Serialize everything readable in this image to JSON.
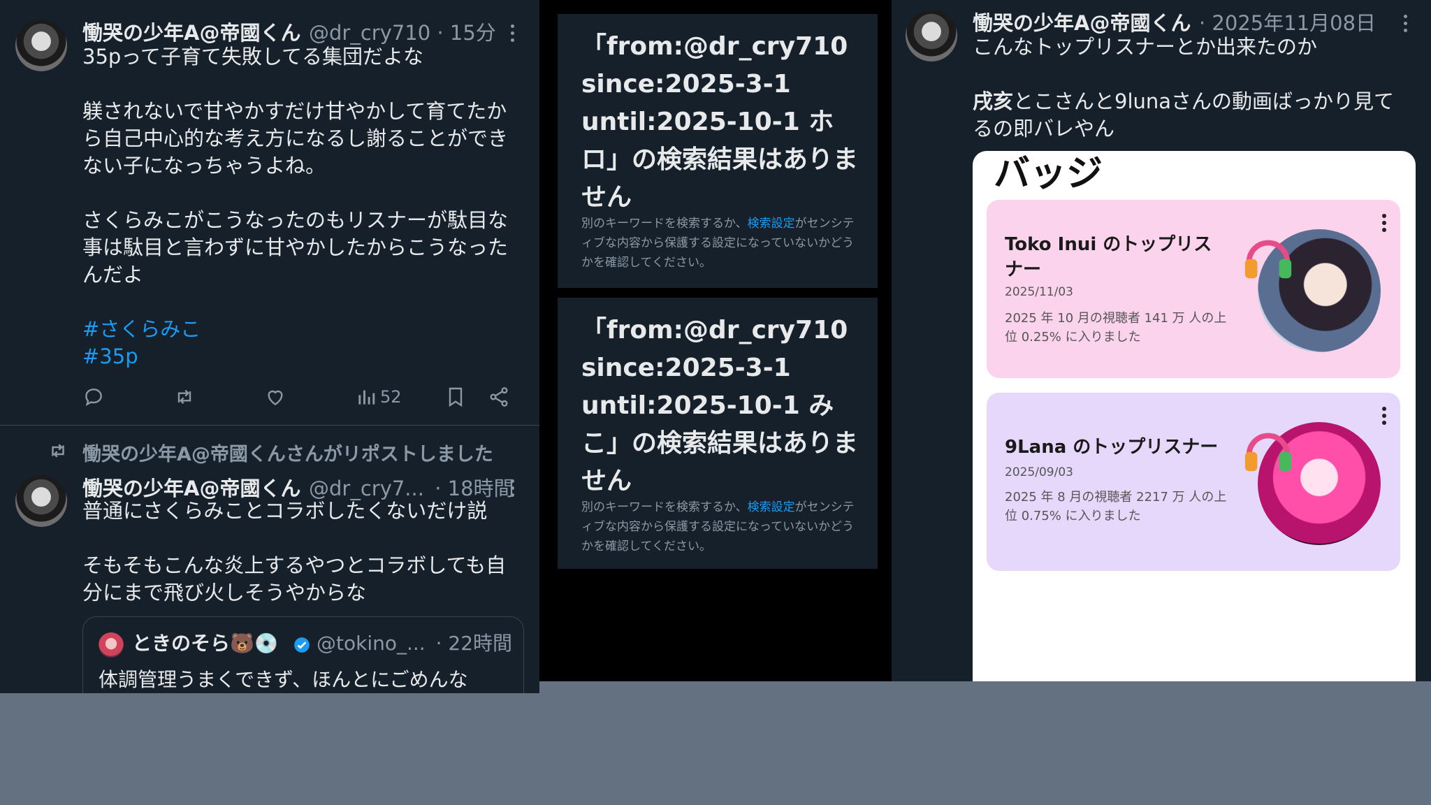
{
  "left": {
    "post1": {
      "name": "慟哭の少年A@帝國くん",
      "handle": "@dr_cry710",
      "time": "· 15分",
      "lines": [
        "35pって子育て失敗してる集団だよな",
        "躾されないで甘やかすだけ甘やかして育てたか",
        "ら自己中心的な考え方になるし謝ることができ",
        "ない子になっちゃうよね。",
        "さくらみこがこうなったのもリスナーが駄目な",
        "事は駄目と言わずに甘やかしたからこうなった",
        "んだよ"
      ],
      "hashtags": [
        "#さくらみこ",
        "#35p"
      ],
      "views": "52"
    },
    "repost_label": "慟哭の少年A@帝國くんさんがリポストしました",
    "post2": {
      "name": "慟哭の少年A@帝國くん",
      "handle": "@dr_cry7...",
      "time": "· 18時間",
      "lines": [
        "普通にさくらみことコラボしたくないだけ説",
        "そもそもこんな炎上するやつとコラボしても自",
        "分にまで飛び火しそうやからな"
      ]
    },
    "quote": {
      "name": "ときのそら🐻💿",
      "handle": "@tokino_...",
      "time": "· 22時間",
      "text": "体調管理うまくできず、ほんとにごめんな"
    }
  },
  "middle": {
    "result1": {
      "title": "「from:@dr_cry710 since:2025-3-1 until:2025-10-1 ホロ」の検索結果はありません",
      "desc_before": "別のキーワードを検索するか、",
      "desc_link": "検索設定",
      "desc_after": "がセンシティブな内容から保護する設定になっていないかどうかを確認してください。"
    },
    "result2": {
      "title": "「from:@dr_cry710 since:2025-3-1 until:2025-10-1 みこ」の検索結果はありません",
      "desc_before": "別のキーワードを検索するか、",
      "desc_link": "検索設定",
      "desc_after": "がセンシティブな内容から保護する設定になっていないかどうかを確認してください。"
    }
  },
  "right": {
    "post": {
      "name": "慟哭の少年A@帝國くん",
      "time": "· 2025年11月08日",
      "line1": "こんなトップリスナーとか出来たのか",
      "line2a": "戌亥",
      "line2b": "とこさんと9lunaさんの動画ばっかり見て",
      "line3": "るの即バレやん"
    },
    "panel_title": "バッジ",
    "badges": [
      {
        "title": "Toko Inui のトップリスナー",
        "date": "2025/11/03",
        "desc": "2025 年 10 月の視聴者 141 万 人の上位 0.25% に入りました",
        "bg": "#fbd3ec"
      },
      {
        "title": "9Lana のトップリスナー",
        "date": "2025/09/03",
        "desc": "2025 年 8 月の視聴者 2217 万 人の上位 0.75% に入りました",
        "bg": "#e6d8fb"
      }
    ]
  },
  "colors": {
    "bg": "#15202b",
    "accent": "#1d9bf0",
    "muted": "#8b98a5",
    "outer": "#637180"
  },
  "icons": [
    "reply-icon",
    "repost-icon",
    "like-icon",
    "views-icon",
    "bookmark-icon",
    "share-icon",
    "more-icon",
    "verified-icon",
    "headphones-icon"
  ]
}
